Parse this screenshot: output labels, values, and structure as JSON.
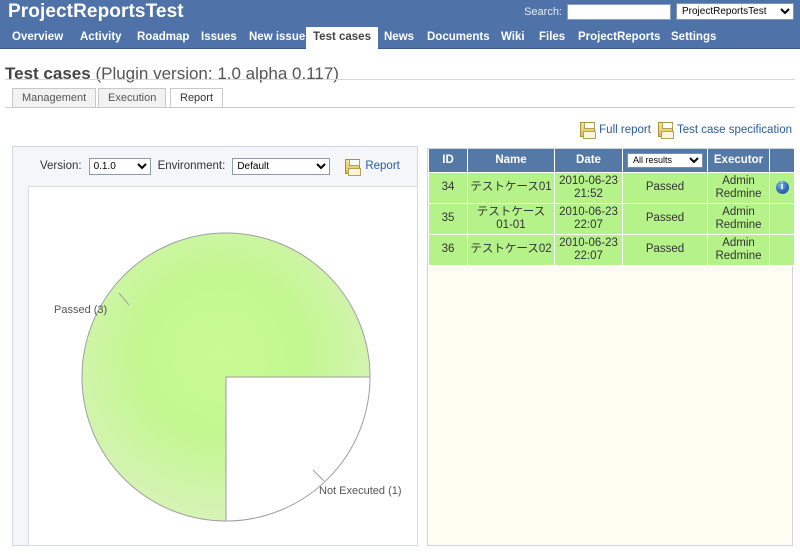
{
  "header": {
    "app_title": "ProjectReportsTest",
    "search_label": "Search:",
    "search_value": "",
    "project_selected": "ProjectReportsTest"
  },
  "main_menu": {
    "items": [
      {
        "label": "Overview",
        "selected": false
      },
      {
        "label": "Activity",
        "selected": false
      },
      {
        "label": "Roadmap",
        "selected": false
      },
      {
        "label": "Issues",
        "selected": false
      },
      {
        "label": "New issue",
        "selected": false
      },
      {
        "label": "Test cases",
        "selected": true
      },
      {
        "label": "News",
        "selected": false
      },
      {
        "label": "Documents",
        "selected": false
      },
      {
        "label": "Wiki",
        "selected": false
      },
      {
        "label": "Files",
        "selected": false
      },
      {
        "label": "ProjectReports",
        "selected": false
      },
      {
        "label": "Settings",
        "selected": false
      }
    ]
  },
  "page": {
    "title_bold": "Test cases",
    "title_rest": "(Plugin version: 1.0 alpha 0.117)"
  },
  "subtabs": [
    {
      "label": "Management",
      "active": false
    },
    {
      "label": "Execution",
      "active": false
    },
    {
      "label": "Report",
      "active": true
    }
  ],
  "report_links": {
    "full_report": "Full report",
    "test_case_specification": "Test case specification"
  },
  "controls": {
    "version_label": "Version:",
    "version_value": "0.1.0",
    "environment_label": "Environment:",
    "environment_value": "Default",
    "report_button": "Report"
  },
  "table": {
    "headers": [
      "ID",
      "Name",
      "Date",
      "",
      "Executor",
      ""
    ],
    "result_filter_value": "All results",
    "rows": [
      {
        "id": "34",
        "name": "テストケース01",
        "date": "2010-06-23 21:52",
        "result": "Passed",
        "executor": "Admin Redmine",
        "has_info": true
      },
      {
        "id": "35",
        "name": "テストケース01-01",
        "date": "2010-06-23 22:07",
        "result": "Passed",
        "executor": "Admin Redmine",
        "has_info": false
      },
      {
        "id": "36",
        "name": "テストケース02",
        "date": "2010-06-23 22:07",
        "result": "Passed",
        "executor": "Admin Redmine",
        "has_info": false
      }
    ]
  },
  "chart_data": {
    "type": "pie",
    "title": "",
    "categories": [
      "Passed",
      "Not Executed"
    ],
    "values": [
      3,
      1
    ],
    "labels": [
      "Passed (3)",
      "Not Executed (1)"
    ],
    "colors": [
      "#b6f28a",
      "#ffffff"
    ],
    "total": 4,
    "legend": "labels-outside",
    "start_angle_deg": 0,
    "direction": "clockwise"
  }
}
